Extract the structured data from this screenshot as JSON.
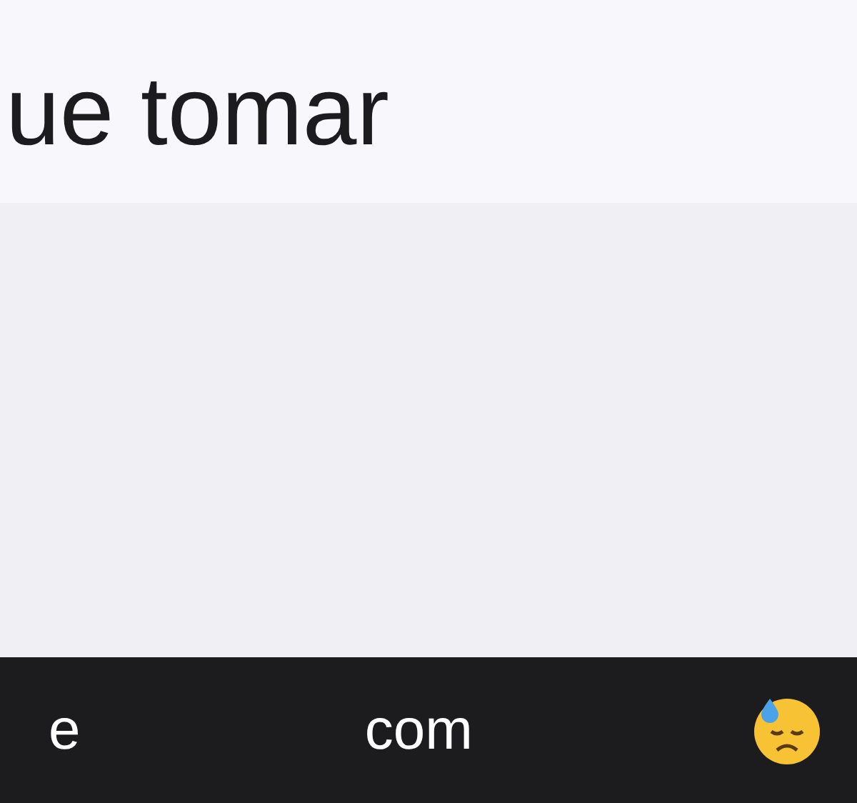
{
  "message": {
    "text": "ue tomar"
  },
  "suggestions": [
    {
      "kind": "text",
      "label": "e"
    },
    {
      "kind": "text",
      "label": "com"
    },
    {
      "kind": "emoji"
    }
  ]
}
